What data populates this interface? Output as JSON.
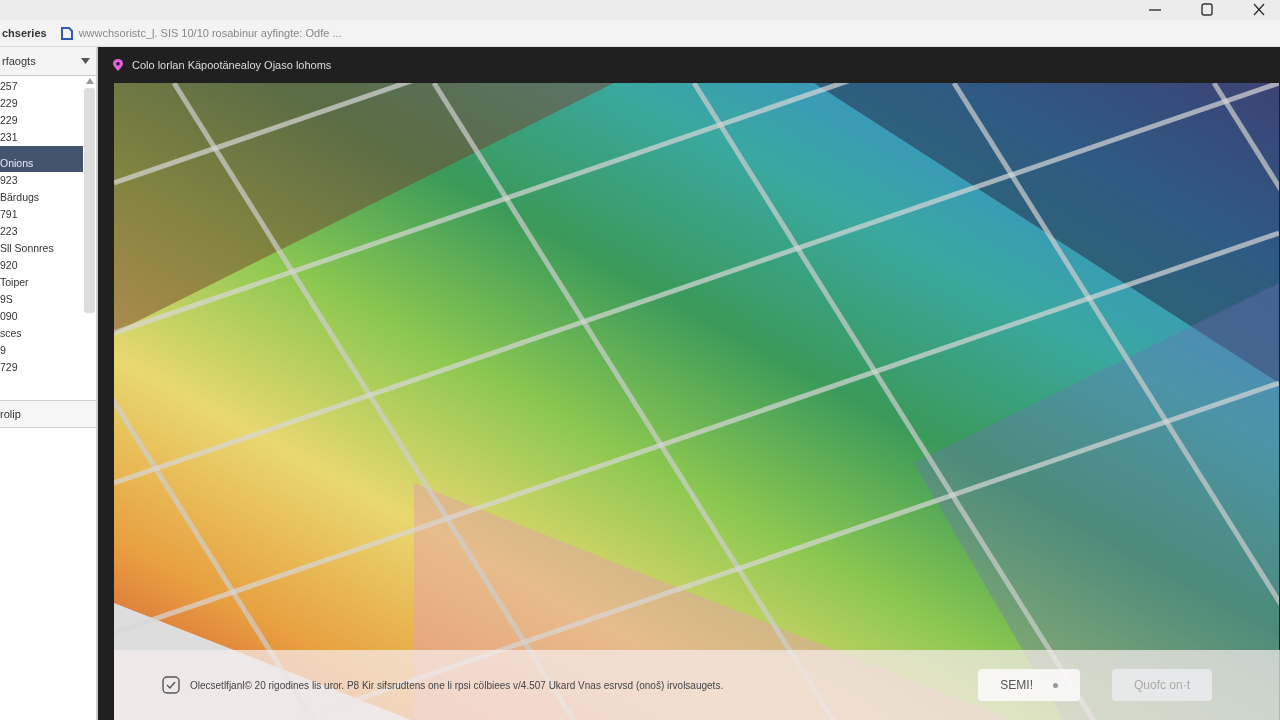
{
  "tab": {
    "title": "chseries",
    "address": "wwwchsoristc_ļ. SIS 10/10 rosabinur ayfingte: Odfe ..."
  },
  "sidebar": {
    "dropdown": "rfaogts",
    "items": [
      {
        "label": "257",
        "selected": false
      },
      {
        "label": "229",
        "selected": false
      },
      {
        "label": "229",
        "selected": false
      },
      {
        "label": "231",
        "selected": false
      },
      {
        "label": "Onions",
        "selected": true
      },
      {
        "label": "923",
        "selected": false
      },
      {
        "label": "Bärdugs",
        "selected": false
      },
      {
        "label": "791",
        "selected": false
      },
      {
        "label": "223",
        "selected": false
      },
      {
        "label": "Sll Sonnres",
        "selected": false
      },
      {
        "label": "920",
        "selected": false
      },
      {
        "label": "Toiper",
        "selected": false
      },
      {
        "label": "9S",
        "selected": false
      },
      {
        "label": "090",
        "selected": false
      },
      {
        "label": "sces",
        "selected": false
      },
      {
        "label": "9",
        "selected": false
      },
      {
        "label": "729",
        "selected": false
      }
    ],
    "footer": "rolip"
  },
  "viewer": {
    "title": "Colo lorlan Käpootänealoy Ojaso lohoms",
    "notice": {
      "checked": true,
      "text": "Olecsetlfjanl© 20 rigodines lis uror. P8 Kir sifsrudtens one li rpsi cölbiees v/4.507 Ukard Vnas esrvsd (onoš) irvolsaugets."
    },
    "buttons": [
      {
        "label": "SEMI!",
        "disabled": false
      },
      {
        "label": "Quofc on·t",
        "disabled": true
      }
    ]
  }
}
